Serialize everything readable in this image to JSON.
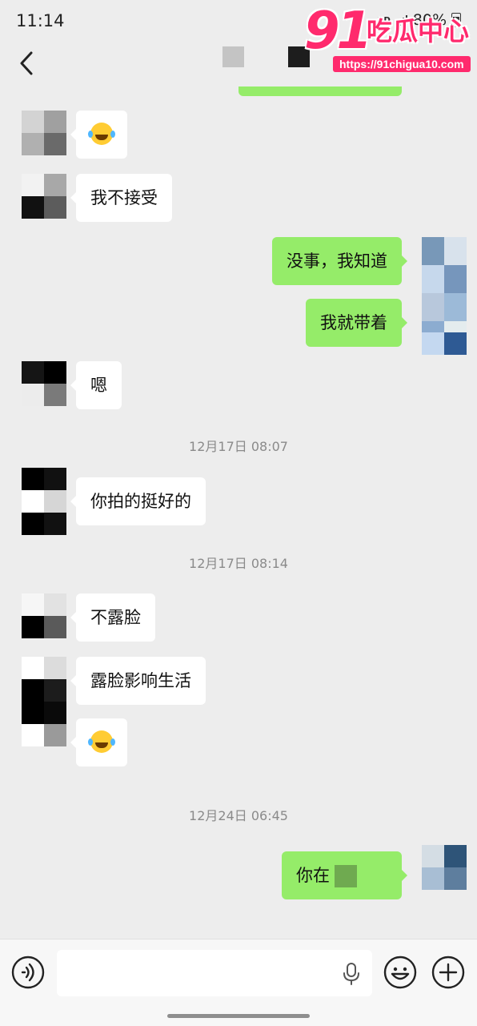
{
  "status": {
    "time": "11:14",
    "network": "HD",
    "battery": "80%"
  },
  "watermark": {
    "num": "91",
    "brand": "吃瓜中心",
    "url": "https://91chigua10.com"
  },
  "messages": {
    "m1": "我不接受",
    "m2": "没事，我知道",
    "m3": "我就带着",
    "m4": "嗯",
    "t1": "12月17日 08:07",
    "m5": "你拍的挺好的",
    "t2": "12月17日 08:14",
    "m6": "不露脸",
    "m7": "露脸影响生活",
    "t3": "12月24日 06:45",
    "m8": "你在"
  },
  "icons": {
    "back": "chevron-left-icon",
    "emoji": "laughing-tears-emoji",
    "voice": "voice-icon",
    "mic": "mic-icon",
    "smiley": "smiley-icon",
    "plus": "plus-circle-icon"
  },
  "colors": {
    "outgoing": "#95ec69",
    "incoming": "#ffffff",
    "background": "#ededed",
    "watermark": "#ff2a6d"
  }
}
